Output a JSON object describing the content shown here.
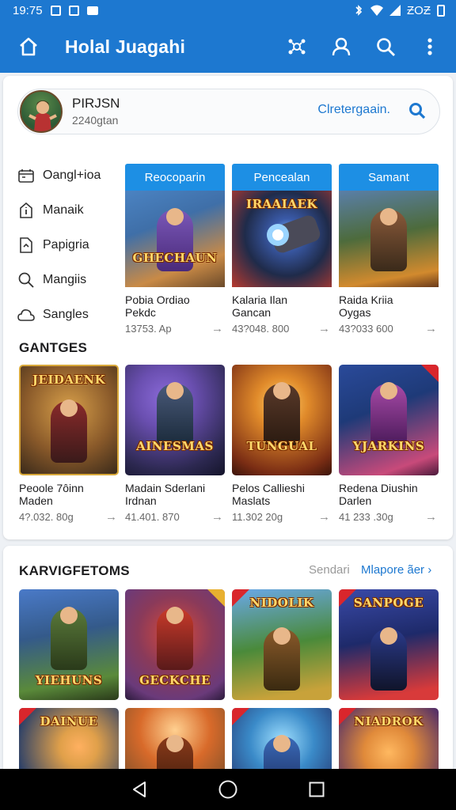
{
  "status": {
    "time": "19:75",
    "right": "ƵOƵ"
  },
  "appbar": {
    "title": "Holal Juagahi"
  },
  "profile": {
    "name": "PIRJSN",
    "subtitle": "2240gtan",
    "link": "Clretergaain."
  },
  "sidebar": {
    "items": [
      {
        "label": "Oangl+ioa",
        "icon": "calendar-icon"
      },
      {
        "label": "Manaik",
        "icon": "info-icon"
      },
      {
        "label": "Papigria",
        "icon": "document-icon"
      },
      {
        "label": "Mangiis",
        "icon": "search-icon"
      },
      {
        "label": "Sangles",
        "icon": "cloud-icon"
      }
    ]
  },
  "featured": [
    {
      "header": "Reocoparin",
      "art_text": "GHECHAUN",
      "title1": "Pobia Ordiao",
      "title2": "Pekdc",
      "meta": "13753. Ap",
      "colors": [
        "#3f6fa8",
        "#c98a46"
      ]
    },
    {
      "header": "Pencealan",
      "art_text": "IRAAIAEK",
      "title1": "Kalaria Ilan",
      "title2": "Gancan",
      "meta": "43?048. 800",
      "colors": [
        "#1f2b4a",
        "#b73a2f"
      ]
    },
    {
      "header": "Samant",
      "art_text": "",
      "title1": "Raida Kriia",
      "title2": "Oygas",
      "meta": "43?033 600",
      "colors": [
        "#4d6b3c",
        "#d28a2e"
      ]
    }
  ],
  "games_section": {
    "title": "GANTGES"
  },
  "games": [
    {
      "art_text": "JEIDAENK",
      "title1": "Peoole 7ôinn",
      "title2": "Maden",
      "meta": "4?.032. 80g",
      "colors": [
        "#8a5a2a",
        "#d8a04a"
      ]
    },
    {
      "art_text": "AINESMAS",
      "title1": "Madain Sderlani",
      "title2": "Irdnan",
      "meta": "41.401. 870",
      "colors": [
        "#2c2850",
        "#6a4fb0"
      ]
    },
    {
      "art_text": "TUNGUAL",
      "title1": "Pelos Callieshi",
      "title2": "Maslats",
      "meta": "11.302 20g",
      "colors": [
        "#7a2d14",
        "#e08a2a"
      ]
    },
    {
      "art_text": "YJARKINS",
      "title1": "Redena Diushin",
      "title2": "Darlen",
      "meta": "41 233 .30g",
      "colors": [
        "#1e3a78",
        "#c84a7a"
      ]
    }
  ],
  "recommended": {
    "title": "KARVIGFETOMS",
    "gray_text": "Sendari",
    "link": "Mlapore ãer ›",
    "row1": [
      {
        "art_text": "YIEHUNS",
        "colors": [
          "#345a8a",
          "#5a8a3a"
        ]
      },
      {
        "art_text": "GECKCHE",
        "colors": [
          "#6a3a7a",
          "#d84a3a"
        ]
      },
      {
        "art_text": "NIDOLIK",
        "colors": [
          "#4a8a3a",
          "#c8a23a"
        ]
      },
      {
        "art_text": "SANPOGE",
        "colors": [
          "#1e2a6a",
          "#d83a3a"
        ]
      }
    ],
    "row2": [
      {
        "art_text": "DAINUE",
        "colors": [
          "#203a6a",
          "#e0a04a"
        ]
      },
      {
        "art_text": "",
        "colors": [
          "#6a4a2a",
          "#d86a2a"
        ]
      },
      {
        "art_text": "",
        "colors": [
          "#24306a",
          "#3a8ac8"
        ]
      },
      {
        "art_text": "NIADROK",
        "colors": [
          "#4a2a6a",
          "#e08a3a"
        ]
      }
    ]
  },
  "accent": "#1d78d0"
}
